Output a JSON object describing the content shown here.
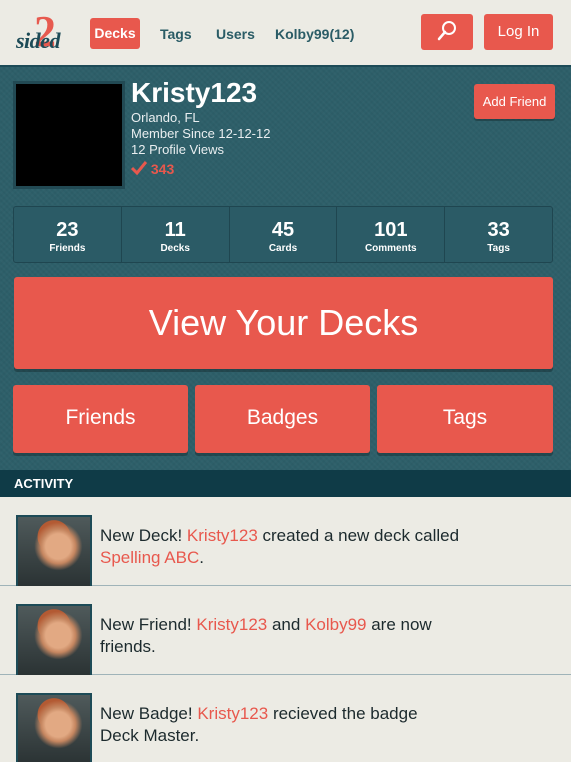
{
  "nav": {
    "logo_word": "sided",
    "logo_mark": "2",
    "items": [
      "Decks",
      "Tags",
      "Users",
      "Kolby99(12)"
    ],
    "search_icon": "search-icon",
    "login_label": "Log In"
  },
  "profile": {
    "name": "Kristy123",
    "location": "Orlando, FL",
    "member_since": "Member Since 12-12-12",
    "views": "12 Profile Views",
    "score": "343",
    "score_icon": "checkmark-icon",
    "add_friend_label": "Add Friend",
    "stats": [
      {
        "num": "23",
        "label": "Friends"
      },
      {
        "num": "11",
        "label": "Decks"
      },
      {
        "num": "45",
        "label": "Cards"
      },
      {
        "num": "101",
        "label": "Comments"
      },
      {
        "num": "33",
        "label": "Tags"
      }
    ],
    "view_decks_label": "View Your Decks",
    "buttons": [
      "Friends",
      "Badges",
      "Tags"
    ]
  },
  "activity": {
    "header": "ACTIVITY",
    "items": [
      {
        "p1": "New Deck! ",
        "h1": "Kristy123",
        "p2": " created a new deck called ",
        "h2": "Spelling ABC",
        "p3": "."
      },
      {
        "p1": "New Friend! ",
        "h1": "Kristy123",
        "p2": " and ",
        "h2": "Kolby99",
        "p3": " are now friends."
      },
      {
        "p1": "New Badge! ",
        "h1": "Kristy123",
        "p2": " recieved the badge Deck Master.",
        "h2": "",
        "p3": ""
      }
    ]
  },
  "colors": {
    "accent": "#e8584d",
    "teal": "#2d5f69",
    "dark_teal": "#0f3b47",
    "background": "#ecebe4"
  }
}
